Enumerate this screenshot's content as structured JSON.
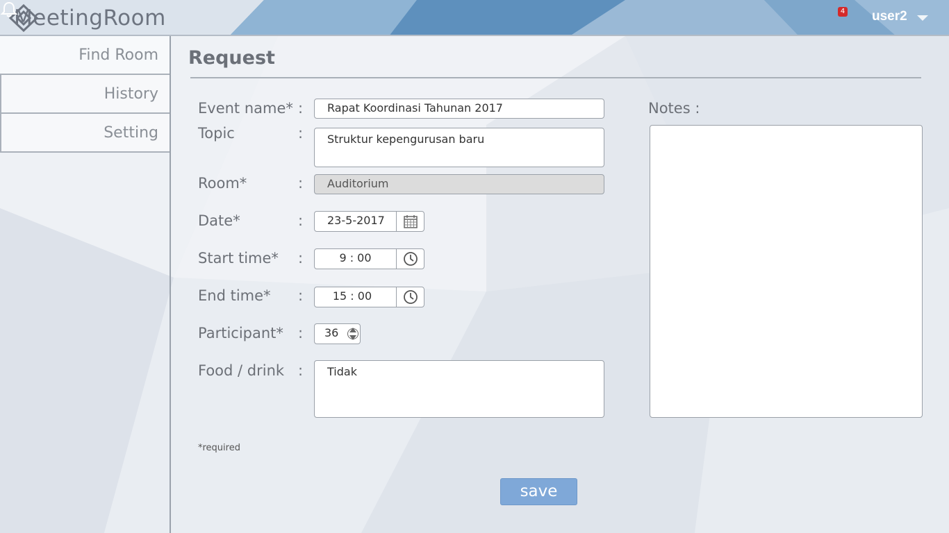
{
  "app": {
    "title": "MeetingRoom"
  },
  "header": {
    "notifications_count": "4",
    "user": "user2"
  },
  "sidebar": {
    "items": [
      {
        "label": "Find Room"
      },
      {
        "label": "History"
      },
      {
        "label": "Setting"
      }
    ]
  },
  "page": {
    "title": "Request"
  },
  "form": {
    "event_name": {
      "label": "Event name*",
      "colon": ":",
      "value": "Rapat Koordinasi Tahunan 2017"
    },
    "topic": {
      "label": "Topic",
      "colon": ":",
      "value": "Struktur kepengurusan baru"
    },
    "room": {
      "label": "Room*",
      "colon": ":",
      "value": "Auditorium"
    },
    "date": {
      "label": "Date*",
      "colon": ":",
      "value": "23-5-2017"
    },
    "start_time": {
      "label": "Start time*",
      "colon": ":",
      "value": "9 : 00"
    },
    "end_time": {
      "label": "End time*",
      "colon": ":",
      "value": "15 : 00"
    },
    "participant": {
      "label": "Participant*",
      "colon": ":",
      "value": "36"
    },
    "food_drink": {
      "label": "Food / drink",
      "colon": ":",
      "value": "Tidak"
    },
    "notes": {
      "label": "Notes :",
      "value": ""
    },
    "required_note": "*required",
    "save_label": "save"
  },
  "colors": {
    "accent": "#7fa8d8",
    "header": "#5f93bf",
    "badge": "#d42a2a"
  }
}
